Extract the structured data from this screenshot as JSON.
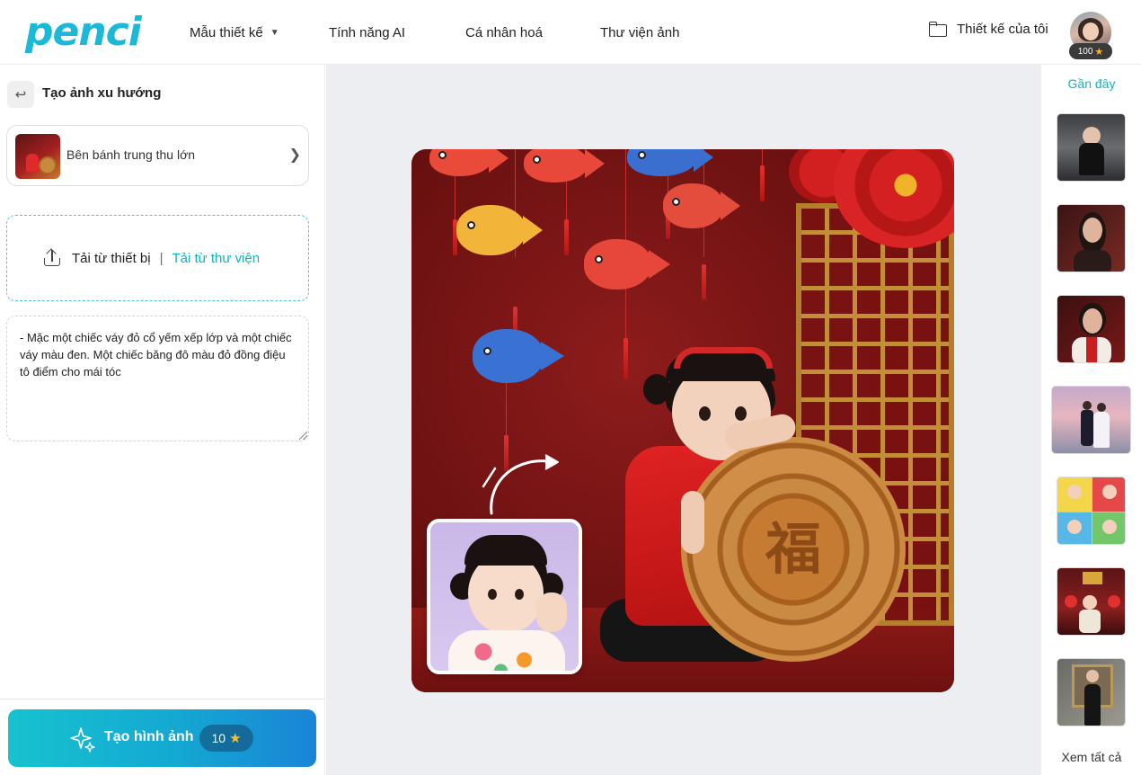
{
  "brand": {
    "logo_text": "penci",
    "accent": "#1cb8d8"
  },
  "nav": {
    "items": [
      {
        "label": "Mẫu thiết kế",
        "has_dropdown": true
      },
      {
        "label": "Tính năng AI"
      },
      {
        "label": "Cá nhân hoá"
      },
      {
        "label": "Thư viện ảnh"
      }
    ],
    "my_designs_label": "Thiết kế của tôi",
    "credits": "100"
  },
  "left_panel": {
    "title": "Tạo ảnh xu hướng",
    "template_name": "Bên bánh trung thu lớn",
    "upload": {
      "from_device": "Tải từ thiết bị",
      "separator": "|",
      "from_library": "Tải từ thư viện"
    },
    "prompt": "- Mặc một chiếc váy đỏ cổ yếm xếp lớp và một chiếc váy màu đen. Một chiếc băng đô màu đỏ đồng điệu tô điểm cho mái tóc",
    "generate_label": "Tạo hình ảnh",
    "generate_cost": "10"
  },
  "preview": {
    "mooncake_character": "福"
  },
  "right_panel": {
    "title": "Gần đây",
    "see_all": "Xem tất cả"
  }
}
